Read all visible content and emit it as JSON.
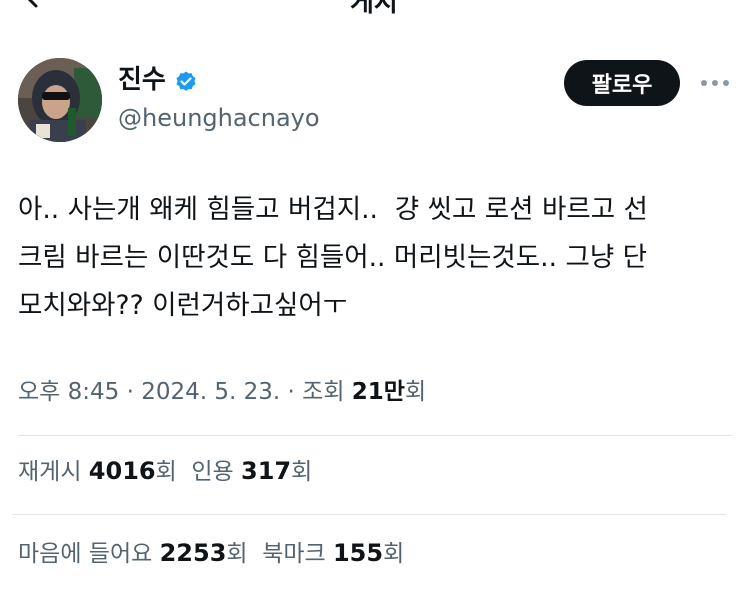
{
  "header": {
    "title_fragment": "게시"
  },
  "author": {
    "name": "진수",
    "handle": "@heunghacnayo",
    "verified": true,
    "verified_color": "#1d9bf0"
  },
  "follow_button": {
    "label": "팔로우"
  },
  "tweet": {
    "text": "아.. 사는개 왜케 힘들고 버겁지..  걍 씻고 로션 바르고 선\n크림 바르는 이딴것도 다 힘들어.. 머리빗는것도.. 그냥 단\n모치와와?? 이런거하고싶어ㅜ"
  },
  "meta": {
    "time": "오후 8:45",
    "separator": " · ",
    "date": "2024. 5. 23.",
    "views_label": "조회",
    "views_value": "21만",
    "views_suffix": "회"
  },
  "stats": {
    "reposts": {
      "label": "재게시",
      "value": "4016",
      "suffix": "회"
    },
    "quotes": {
      "label": "인용",
      "value": "317",
      "suffix": "회"
    },
    "likes": {
      "label": "마음에 들어요",
      "value": "2253",
      "suffix": "회"
    },
    "bookmarks": {
      "label": "북마크",
      "value": "155",
      "suffix": "회"
    }
  },
  "icons": {
    "back": "arrow-left-icon",
    "verified": "verified-badge-icon",
    "more": "more-horizontal-icon"
  }
}
